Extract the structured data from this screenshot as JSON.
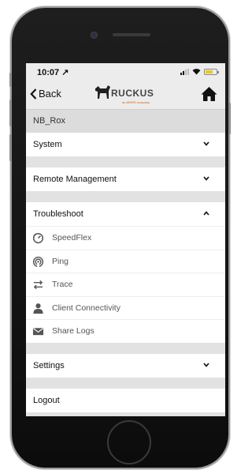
{
  "status_bar": {
    "time": "10:07"
  },
  "nav": {
    "back_label": "Back",
    "logo_text": "RUCKUS",
    "logo_tagline": "an ARRIS company"
  },
  "device": {
    "name": "NB_Rox"
  },
  "menu": {
    "system": "System",
    "remote_management": "Remote Management",
    "troubleshoot": "Troubleshoot",
    "troubleshoot_items": [
      {
        "label": "SpeedFlex",
        "icon": "speedometer-icon"
      },
      {
        "label": "Ping",
        "icon": "ping-icon"
      },
      {
        "label": "Trace",
        "icon": "trace-icon"
      },
      {
        "label": "Client Connectivity",
        "icon": "person-icon"
      },
      {
        "label": "Share Logs",
        "icon": "envelope-icon"
      }
    ],
    "settings": "Settings",
    "logout": "Logout"
  },
  "colors": {
    "battery": "#f0c419",
    "brand_orange": "#e25b00"
  }
}
